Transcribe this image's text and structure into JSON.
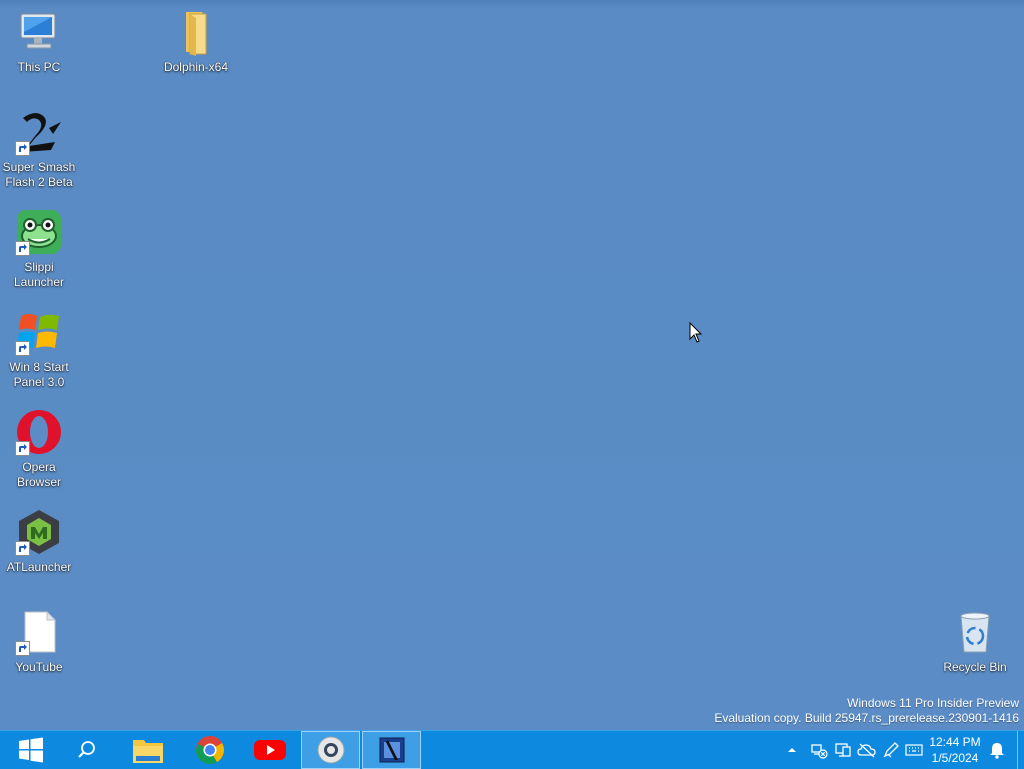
{
  "desktop": {
    "icons": [
      {
        "label": "This PC",
        "icon": "computer-icon"
      },
      {
        "label": "Dolphin-x64",
        "icon": "folder-icon"
      },
      {
        "label": "Super Smash Flash 2 Beta",
        "icon": "ssf2-icon"
      },
      {
        "label": "Slippi Launcher",
        "icon": "frog-icon"
      },
      {
        "label": "Win 8 Start Panel 3.0",
        "icon": "windows-logo-icon"
      },
      {
        "label": "Opera Browser",
        "icon": "opera-icon"
      },
      {
        "label": "ATLauncher",
        "icon": "atlauncher-icon"
      },
      {
        "label": "YouTube",
        "icon": "blank-file-icon"
      },
      {
        "label": "Recycle Bin",
        "icon": "recycle-bin-icon"
      }
    ]
  },
  "watermark": {
    "line1": "Windows 11 Pro Insider Preview",
    "line2": "Evaluation copy. Build 25947.rs_prerelease.230901-1416"
  },
  "taskbar": {
    "items": [
      "start-icon",
      "search-icon",
      "file-explorer-icon",
      "chrome-icon",
      "youtube-icon",
      "obs-icon",
      "video-editor-icon"
    ],
    "tray_icons": [
      "chevron-up-icon",
      "network-icon",
      "display-icon",
      "cloud-icon",
      "pen-icon",
      "keyboard-icon"
    ],
    "time": "12:44 PM",
    "date": "1/5/2024",
    "notification_icon": "notification-bell-icon",
    "accent_color": "#0d8ae0"
  },
  "colors": {
    "desktop_background": "#5b8cc5",
    "taskbar": "#0d8ae0"
  }
}
